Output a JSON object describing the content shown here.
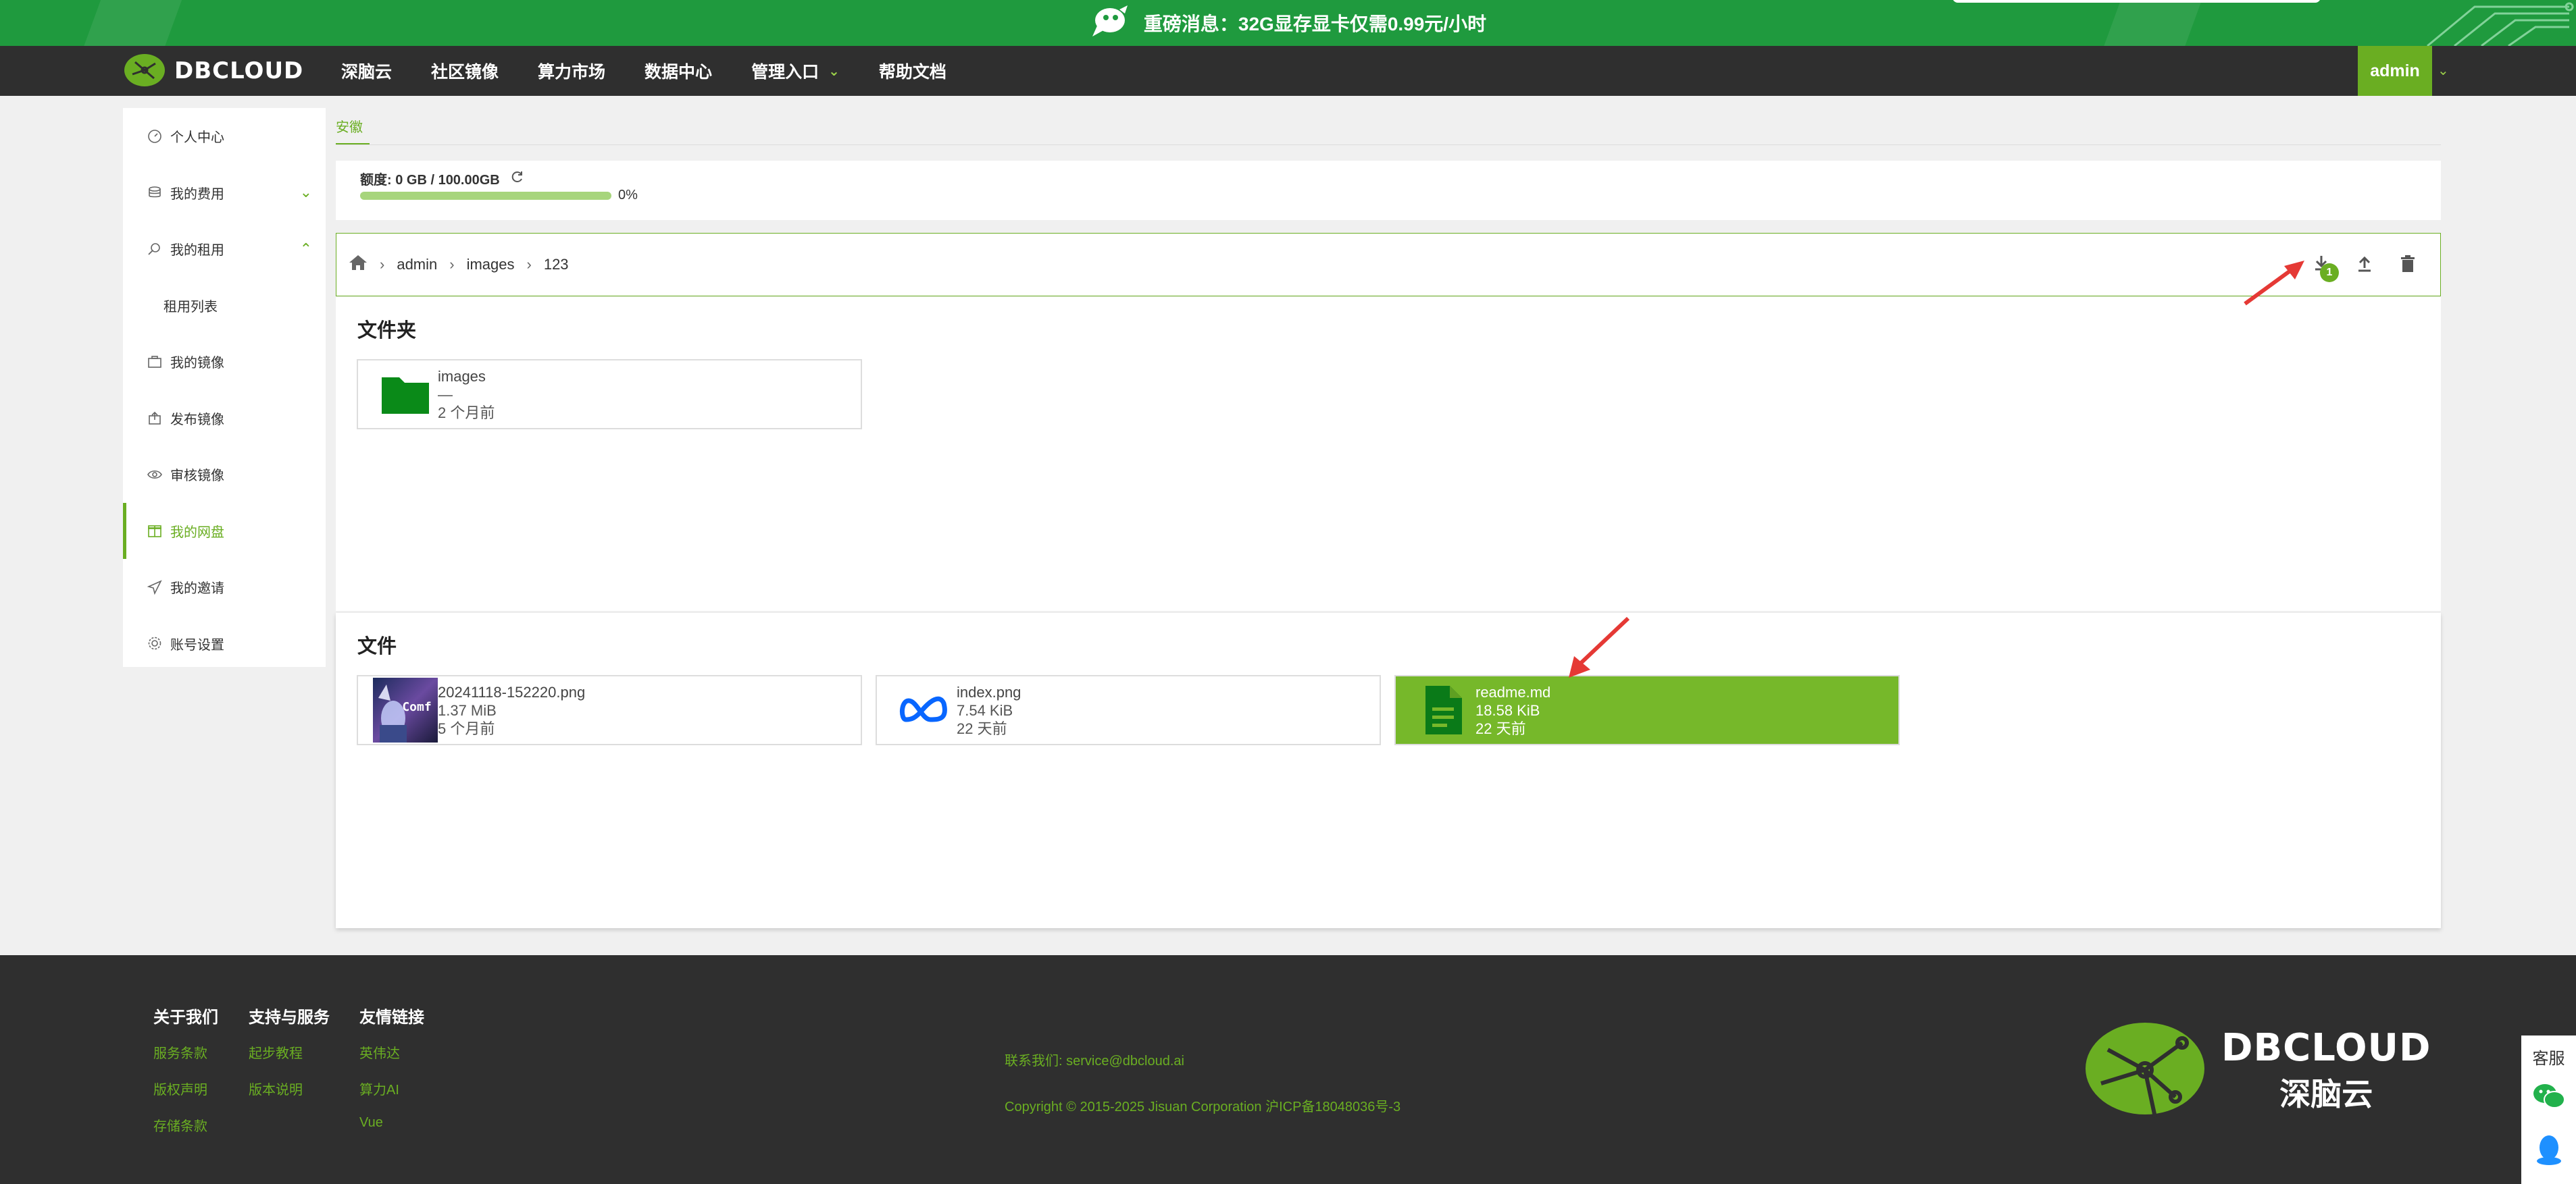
{
  "banner": {
    "text": "重磅消息：32G显存显卡仅需0.99元/小时"
  },
  "nav": {
    "logo_text": "DBCLOUD",
    "items": [
      "深脑云",
      "社区镜像",
      "算力市场",
      "数据中心",
      "管理入口",
      "帮助文档"
    ],
    "user": "admin"
  },
  "sidebar": {
    "items": [
      {
        "label": "个人中心",
        "icon": "dashboard-icon"
      },
      {
        "label": "我的费用",
        "icon": "coins-icon"
      },
      {
        "label": "我的租用",
        "icon": "search-icon"
      },
      {
        "label": "租用列表",
        "icon": ""
      },
      {
        "label": "我的镜像",
        "icon": "briefcase-icon"
      },
      {
        "label": "发布镜像",
        "icon": "publish-icon"
      },
      {
        "label": "审核镜像",
        "icon": "eye-icon"
      },
      {
        "label": "我的网盘",
        "icon": "package-icon"
      },
      {
        "label": "我的邀请",
        "icon": "send-icon"
      },
      {
        "label": "账号设置",
        "icon": "gear-icon"
      }
    ]
  },
  "tab": {
    "label": "安徽"
  },
  "quota": {
    "label": "额度: 0 GB / 100.00GB",
    "percent_text": "0%",
    "fraction": 0
  },
  "breadcrumb": [
    "admin",
    "images",
    "123"
  ],
  "download_badge": "1",
  "folders": {
    "title": "文件夹",
    "items": [
      {
        "name": "images",
        "size": "—",
        "time": "2 个月前"
      }
    ]
  },
  "files": {
    "title": "文件",
    "items": [
      {
        "name": "20241118-152220.png",
        "size": "1.37 MiB",
        "time": "5 个月前",
        "thumb_text": "Comf"
      },
      {
        "name": "index.png",
        "size": "7.54 KiB",
        "time": "22 天前"
      },
      {
        "name": "readme.md",
        "size": "18.58 KiB",
        "time": "22 天前"
      }
    ]
  },
  "footer": {
    "cols": [
      {
        "head": "关于我们",
        "links": [
          "服务条款",
          "版权声明",
          "存储条款"
        ]
      },
      {
        "head": "支持与服务",
        "links": [
          "起步教程",
          "版本说明"
        ]
      },
      {
        "head": "友情链接",
        "links": [
          "英伟达",
          "算力AI",
          "Vue"
        ]
      }
    ],
    "contact": "联系我们: service@dbcloud.ai",
    "copyright": "Copyright © 2015-2025 Jisuan Corporation 沪ICP备18048036号-3",
    "logo_en": "DBCLOUD",
    "logo_cn": "深脑云"
  },
  "service": {
    "label": "客服"
  },
  "colors": {
    "accent": "#6aae22",
    "banner": "#1f9a3e",
    "nav": "#2f2f2f",
    "folder": "#0a8a18"
  }
}
